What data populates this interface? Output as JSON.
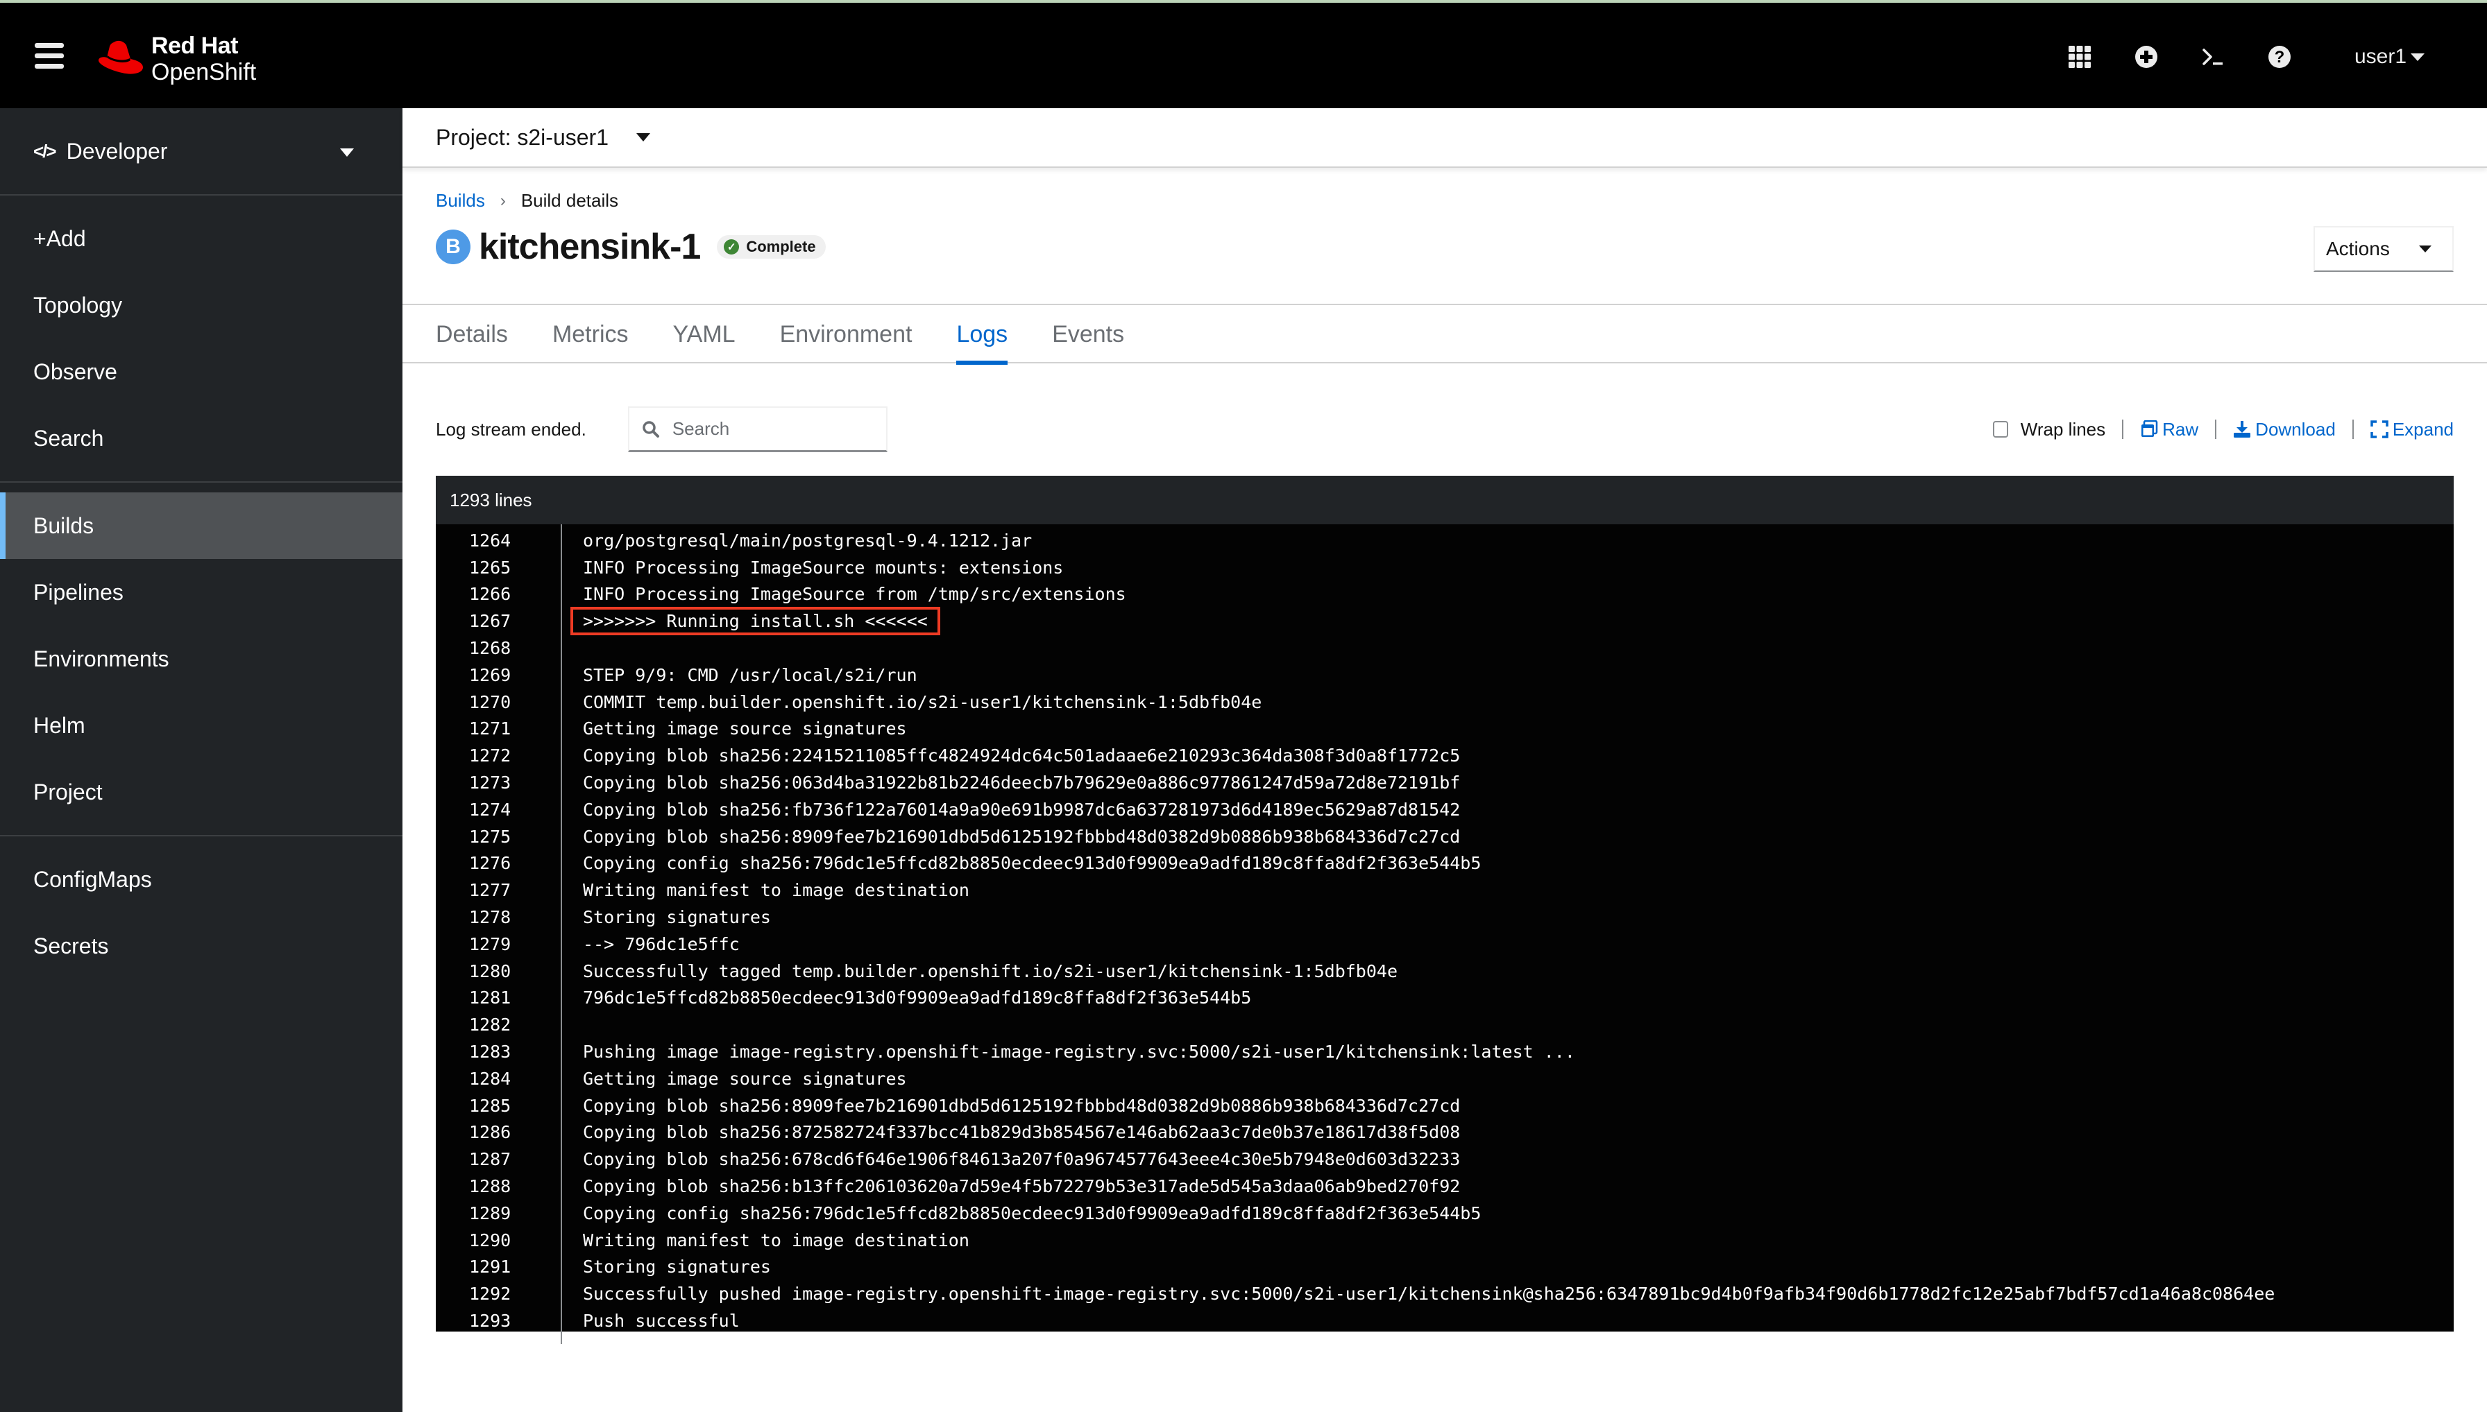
{
  "masthead": {
    "brand_line1": "Red Hat",
    "brand_line2": "OpenShift",
    "icons": [
      "grid-icon",
      "plus-circle-icon",
      "terminal-icon",
      "help-icon"
    ],
    "user": "user1"
  },
  "sidebar": {
    "perspective": "Developer",
    "groups": [
      [
        {
          "label": "+Add"
        },
        {
          "label": "Topology"
        },
        {
          "label": "Observe"
        },
        {
          "label": "Search"
        }
      ],
      [
        {
          "label": "Builds",
          "active": true
        },
        {
          "label": "Pipelines"
        },
        {
          "label": "Environments"
        },
        {
          "label": "Helm"
        },
        {
          "label": "Project"
        }
      ],
      [
        {
          "label": "ConfigMaps"
        },
        {
          "label": "Secrets"
        }
      ]
    ]
  },
  "project_bar": {
    "label": "Project: s2i-user1"
  },
  "breadcrumb": {
    "parent": "Builds",
    "current": "Build details"
  },
  "page": {
    "badge": "B",
    "title": "kitchensink-1",
    "status": "Complete",
    "actions_label": "Actions"
  },
  "tabs": [
    {
      "label": "Details"
    },
    {
      "label": "Metrics"
    },
    {
      "label": "YAML"
    },
    {
      "label": "Environment"
    },
    {
      "label": "Logs",
      "active": true
    },
    {
      "label": "Events"
    }
  ],
  "log_toolbar": {
    "status": "Log stream ended.",
    "search_placeholder": "Search",
    "search_value": "",
    "wrap_lines_label": "Wrap lines",
    "wrap_lines_checked": false,
    "raw_label": "Raw",
    "download_label": "Download",
    "expand_label": "Expand"
  },
  "log": {
    "line_count_label": "1293 lines",
    "highlight_color": "#ee3b24",
    "lines": [
      {
        "n": "1264",
        "text": "org/postgresql/main/postgresql-9.4.1212.jar"
      },
      {
        "n": "1265",
        "text": "INFO Processing ImageSource mounts: extensions"
      },
      {
        "n": "1266",
        "text": "INFO Processing ImageSource from /tmp/src/extensions"
      },
      {
        "n": "1267",
        "text": ">>>>>>> Running install.sh <<<<<<",
        "highlight": true
      },
      {
        "n": "1268",
        "text": ""
      },
      {
        "n": "1269",
        "text": "STEP 9/9: CMD /usr/local/s2i/run"
      },
      {
        "n": "1270",
        "text": "COMMIT temp.builder.openshift.io/s2i-user1/kitchensink-1:5dbfb04e"
      },
      {
        "n": "1271",
        "text": "Getting image source signatures"
      },
      {
        "n": "1272",
        "text": "Copying blob sha256:22415211085ffc4824924dc64c501adaae6e210293c364da308f3d0a8f1772c5"
      },
      {
        "n": "1273",
        "text": "Copying blob sha256:063d4ba31922b81b2246deecb7b79629e0a886c977861247d59a72d8e72191bf"
      },
      {
        "n": "1274",
        "text": "Copying blob sha256:fb736f122a76014a9a90e691b9987dc6a637281973d6d4189ec5629a87d81542"
      },
      {
        "n": "1275",
        "text": "Copying blob sha256:8909fee7b216901dbd5d6125192fbbbd48d0382d9b0886b938b684336d7c27cd"
      },
      {
        "n": "1276",
        "text": "Copying config sha256:796dc1e5ffcd82b8850ecdeec913d0f9909ea9adfd189c8ffa8df2f363e544b5"
      },
      {
        "n": "1277",
        "text": "Writing manifest to image destination"
      },
      {
        "n": "1278",
        "text": "Storing signatures"
      },
      {
        "n": "1279",
        "text": "--> 796dc1e5ffc"
      },
      {
        "n": "1280",
        "text": "Successfully tagged temp.builder.openshift.io/s2i-user1/kitchensink-1:5dbfb04e"
      },
      {
        "n": "1281",
        "text": "796dc1e5ffcd82b8850ecdeec913d0f9909ea9adfd189c8ffa8df2f363e544b5"
      },
      {
        "n": "1282",
        "text": ""
      },
      {
        "n": "1283",
        "text": "Pushing image image-registry.openshift-image-registry.svc:5000/s2i-user1/kitchensink:latest ..."
      },
      {
        "n": "1284",
        "text": "Getting image source signatures"
      },
      {
        "n": "1285",
        "text": "Copying blob sha256:8909fee7b216901dbd5d6125192fbbbd48d0382d9b0886b938b684336d7c27cd"
      },
      {
        "n": "1286",
        "text": "Copying blob sha256:872582724f337bcc41b829d3b854567e146ab62aa3c7de0b37e18617d38f5d08"
      },
      {
        "n": "1287",
        "text": "Copying blob sha256:678cd6f646e1906f84613a207f0a9674577643eee4c30e5b7948e0d603d32233"
      },
      {
        "n": "1288",
        "text": "Copying blob sha256:b13ffc206103620a7d59e4f5b72279b53e317ade5d545a3daa06ab9bed270f92"
      },
      {
        "n": "1289",
        "text": "Copying config sha256:796dc1e5ffcd82b8850ecdeec913d0f9909ea9adfd189c8ffa8df2f363e544b5"
      },
      {
        "n": "1290",
        "text": "Writing manifest to image destination"
      },
      {
        "n": "1291",
        "text": "Storing signatures"
      },
      {
        "n": "1292",
        "text": "Successfully pushed image-registry.openshift-image-registry.svc:5000/s2i-user1/kitchensink@sha256:6347891bc9d4b0f9afb34f90d6b1778d2fc12e25abf7bdf57cd1a46a8c0864ee"
      },
      {
        "n": "1293",
        "text": "Push successful"
      }
    ]
  }
}
